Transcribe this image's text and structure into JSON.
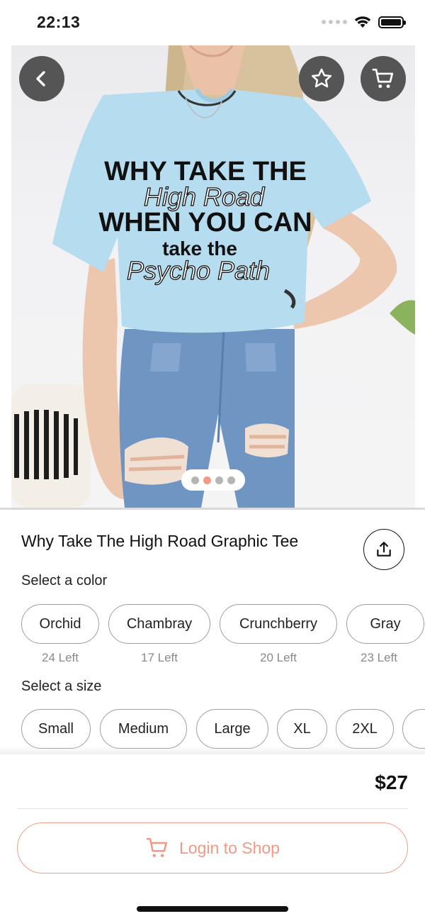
{
  "status_bar": {
    "time": "22:13"
  },
  "product_image": {
    "shirt_print_lines": [
      "WHY TAKE THE",
      "High Road",
      "WHEN YOU CAN",
      "take the",
      "Psycho Path"
    ],
    "pager": {
      "count": 4,
      "active_index": 1
    }
  },
  "icons": {
    "back": "chevron-left-icon",
    "favorite": "star-icon",
    "cart": "cart-icon",
    "share": "share-icon"
  },
  "product": {
    "title": "Why Take The High Road Graphic Tee",
    "color_label": "Select a color",
    "colors": [
      {
        "name": "Orchid",
        "left": "24 Left"
      },
      {
        "name": "Chambray",
        "left": "17 Left"
      },
      {
        "name": "Crunchberry",
        "left": "20 Left"
      },
      {
        "name": "Gray",
        "left": "23 Left"
      }
    ],
    "size_label": "Select a size",
    "sizes": [
      "Small",
      "Medium",
      "Large",
      "XL",
      "2XL"
    ],
    "price": "$27"
  },
  "cta": {
    "login_label": "Login to Shop"
  },
  "colors": {
    "accent": "#ef9a86",
    "icon_button_bg": "#555555",
    "shirt": "#b6dcef",
    "denim": "#6f95c2"
  }
}
